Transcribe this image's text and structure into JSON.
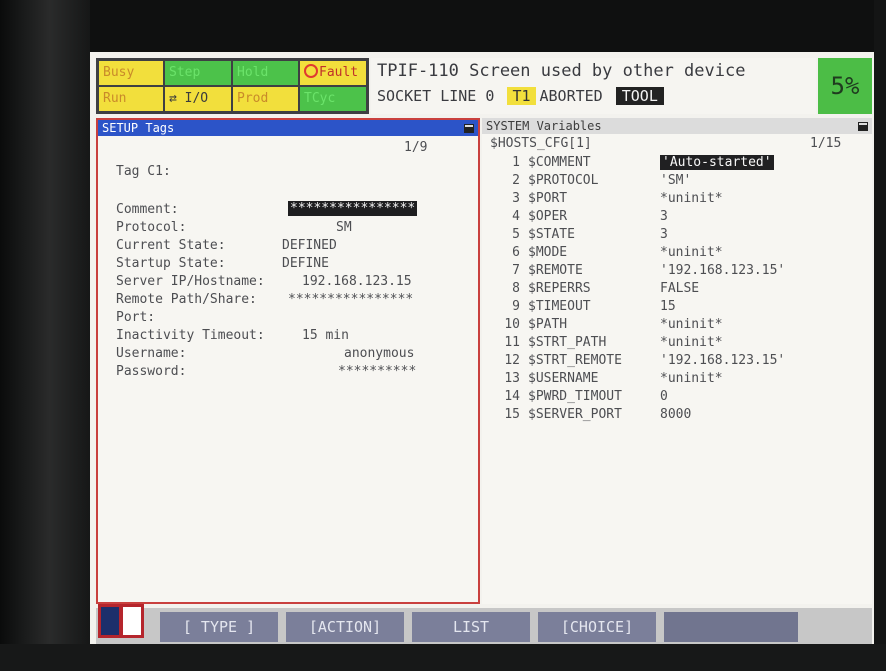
{
  "status_indicators": {
    "busy": "Busy",
    "step": "Step",
    "hold": "Hold",
    "fault": "Fault",
    "run": "Run",
    "io": "I/O",
    "prod": "Prod",
    "tcyc": "TCyc"
  },
  "status_message": {
    "line1": "TPIF-110 Screen used by other device",
    "line2_prefix": "SOCKET LINE 0",
    "mode": "T1",
    "state": "ABORTED",
    "tool": "TOOL"
  },
  "override_percent": "5%",
  "left_panel": {
    "title": "SETUP Tags",
    "page": "1/9",
    "tag": "Tag C1:",
    "fields": [
      {
        "label": "Comment:",
        "value": "****************"
      },
      {
        "label": "Protocol:",
        "value": "SM"
      },
      {
        "label": "Current State:",
        "value": "DEFINED"
      },
      {
        "label": "Startup State:",
        "value": "DEFINE"
      },
      {
        "label": "Server IP/Hostname:",
        "value": "192.168.123.15"
      },
      {
        "label": "Remote Path/Share:",
        "value": "****************"
      },
      {
        "label": "Port:",
        "value": ""
      },
      {
        "label": "Inactivity Timeout:",
        "value": "15 min"
      },
      {
        "label": "Username:",
        "value": "anonymous"
      },
      {
        "label": "Password:",
        "value": "**********"
      }
    ]
  },
  "right_panel": {
    "title": "SYSTEM Variables",
    "header": "$HOSTS_CFG[1]",
    "page": "1/15",
    "rows": [
      {
        "num": "1",
        "name": "$COMMENT",
        "value": "'Auto-started'"
      },
      {
        "num": "2",
        "name": "$PROTOCOL",
        "value": "'SM'"
      },
      {
        "num": "3",
        "name": "$PORT",
        "value": "*uninit*"
      },
      {
        "num": "4",
        "name": "$OPER",
        "value": "3"
      },
      {
        "num": "5",
        "name": "$STATE",
        "value": "3"
      },
      {
        "num": "6",
        "name": "$MODE",
        "value": "*uninit*"
      },
      {
        "num": "7",
        "name": "$REMOTE",
        "value": "'192.168.123.15'"
      },
      {
        "num": "8",
        "name": "$REPERRS",
        "value": "FALSE"
      },
      {
        "num": "9",
        "name": "$TIMEOUT",
        "value": "15"
      },
      {
        "num": "10",
        "name": "$PATH",
        "value": "*uninit*"
      },
      {
        "num": "11",
        "name": "$STRT_PATH",
        "value": "*uninit*"
      },
      {
        "num": "12",
        "name": "$STRT_REMOTE",
        "value": "'192.168.123.15'"
      },
      {
        "num": "13",
        "name": "$USERNAME",
        "value": "*uninit*"
      },
      {
        "num": "14",
        "name": "$PWRD_TIMOUT",
        "value": "0"
      },
      {
        "num": "15",
        "name": "$SERVER_PORT",
        "value": "8000"
      }
    ]
  },
  "function_keys": [
    "[ TYPE ]",
    "[ACTION]",
    "LIST",
    "[CHOICE]",
    ""
  ]
}
